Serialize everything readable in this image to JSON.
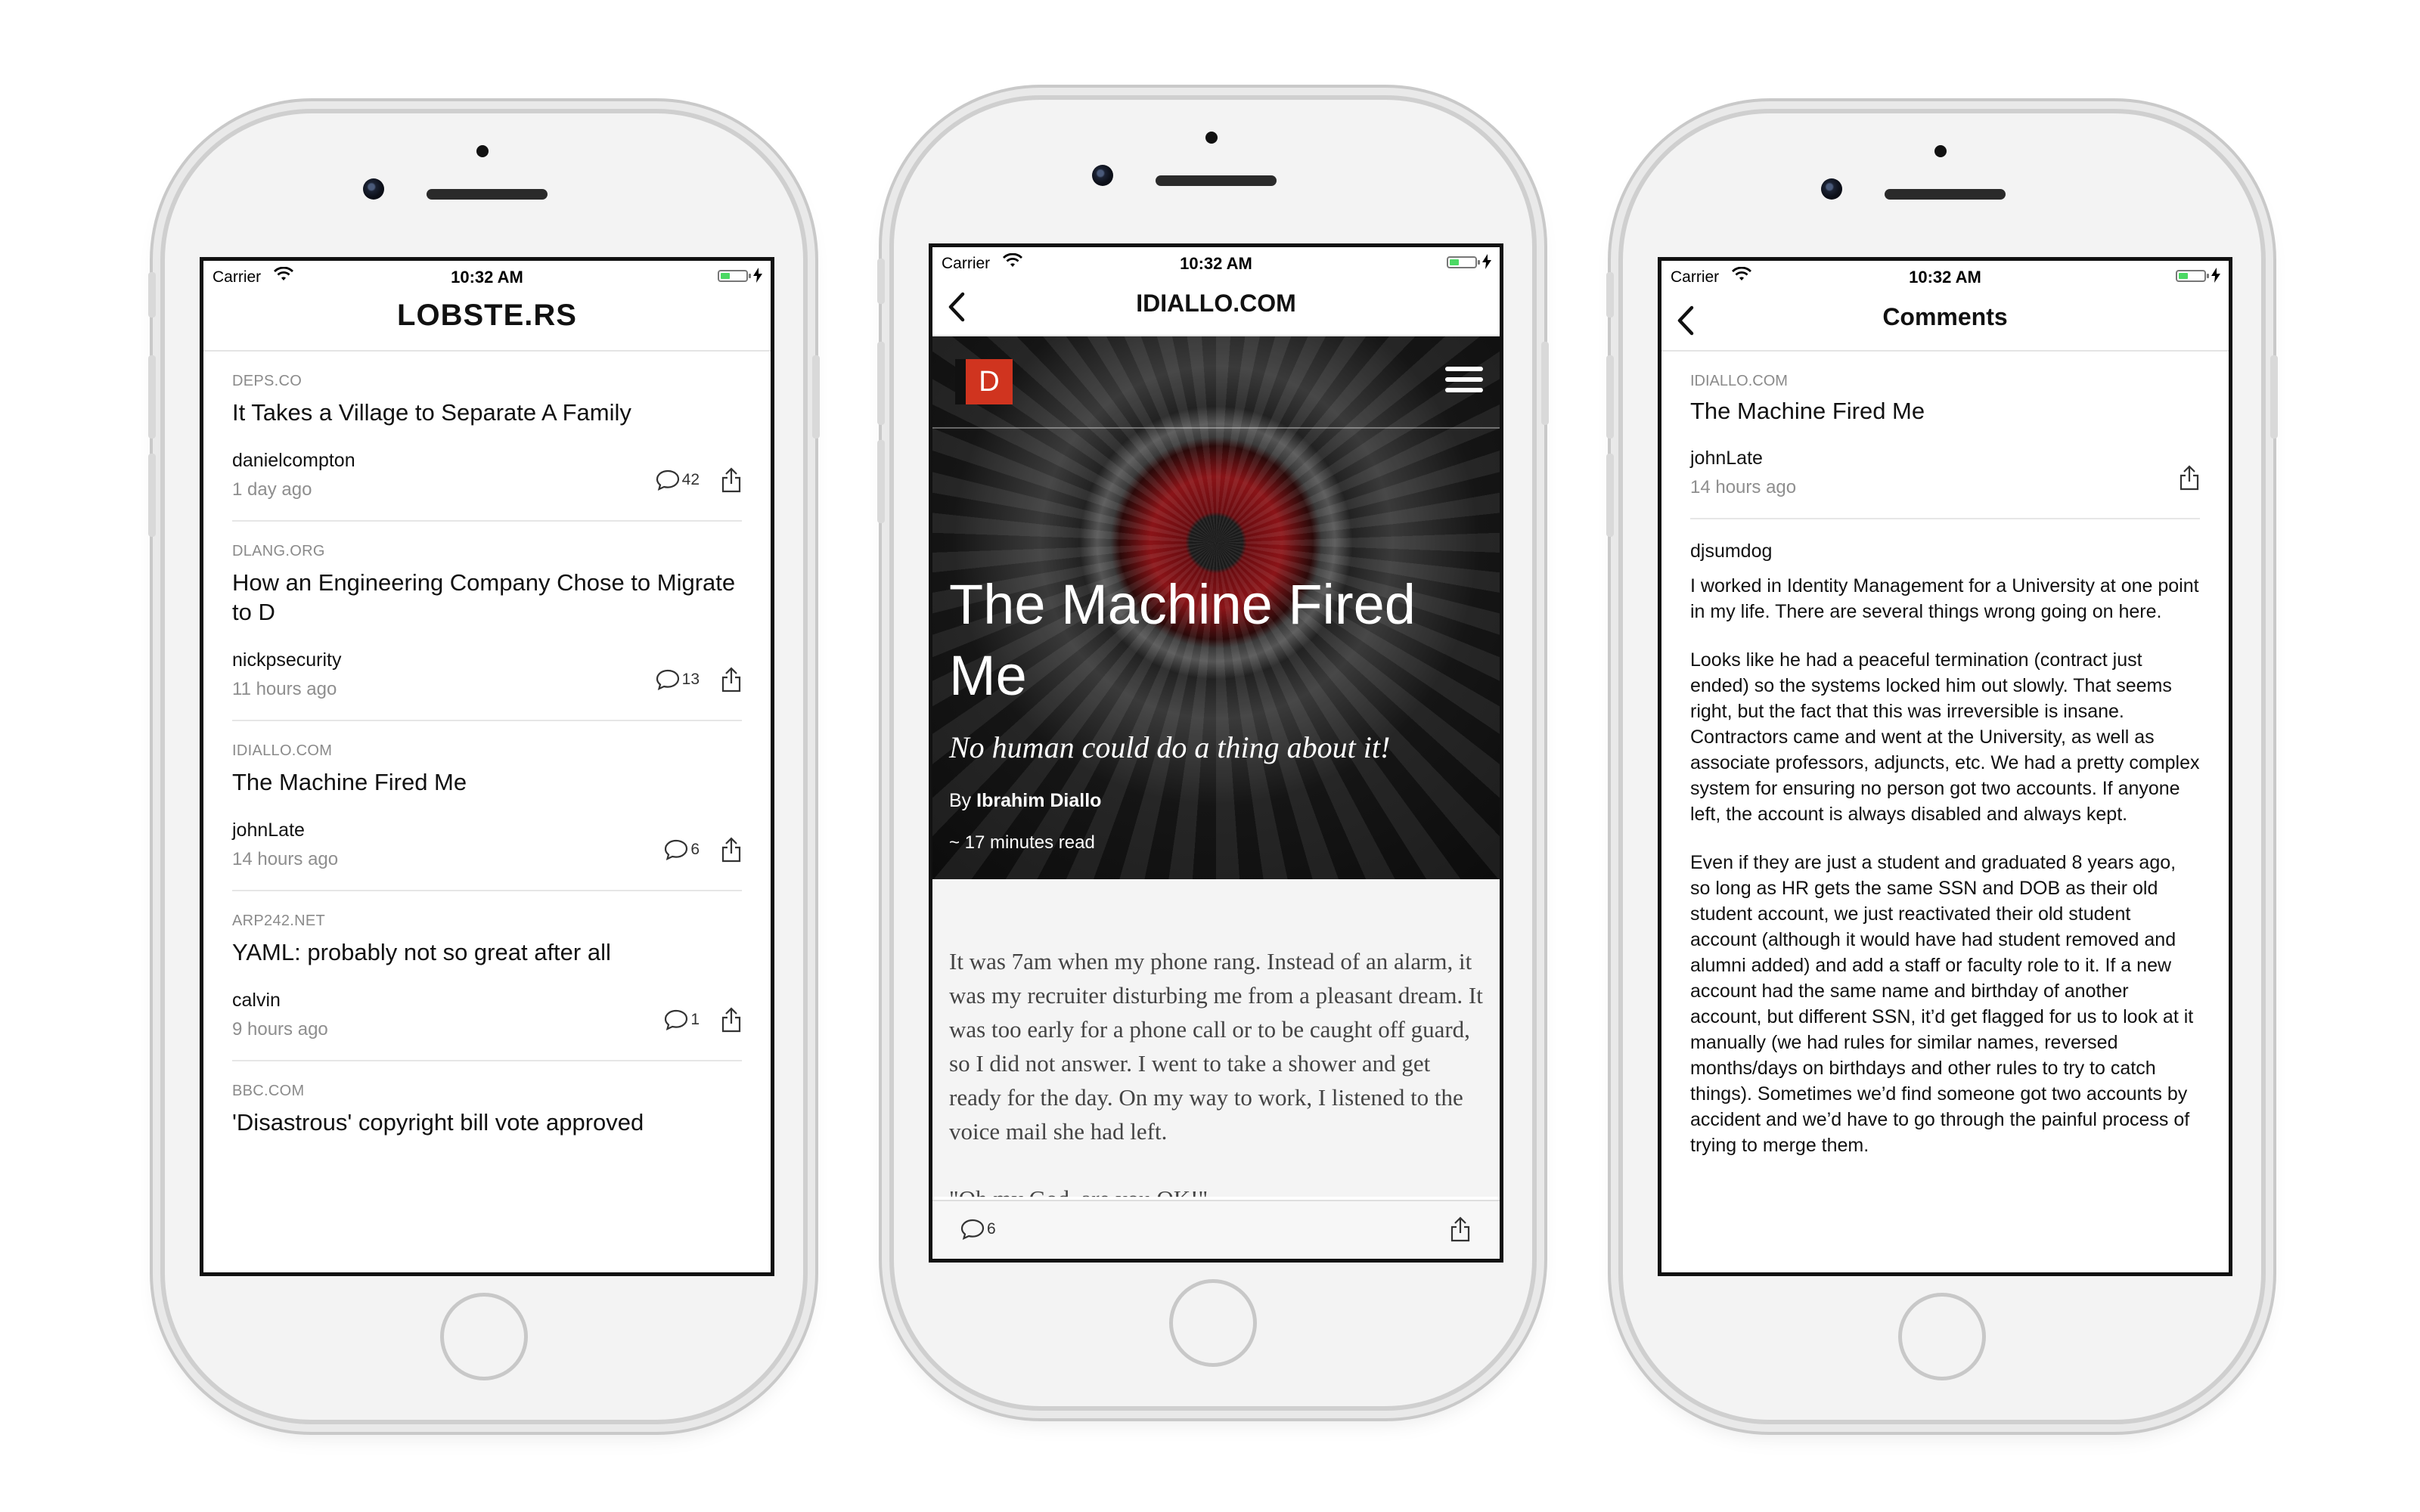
{
  "status_bar": {
    "carrier": "Carrier",
    "time": "10:32 AM"
  },
  "colors": {
    "battery_green": "#4cd964",
    "logo_red": "#d0341f",
    "accent": "#111111"
  },
  "list_screen": {
    "nav_title": "LOBSTE.RS",
    "stories": [
      {
        "domain": "DEPS.CO",
        "title": "It Takes a Village to Separate A Family",
        "author": "danielcompton",
        "time": "1 day ago",
        "comments": "42"
      },
      {
        "domain": "DLANG.ORG",
        "title": "How an Engineering Company Chose to Migrate to D",
        "author": "nickpsecurity",
        "time": "11 hours ago",
        "comments": "13"
      },
      {
        "domain": "IDIALLO.COM",
        "title": "The Machine Fired Me",
        "author": "johnLate",
        "time": "14 hours ago",
        "comments": "6"
      },
      {
        "domain": "ARP242.NET",
        "title": "YAML: probably not so great after all",
        "author": "calvin",
        "time": "9 hours ago",
        "comments": "1"
      },
      {
        "domain": "BBC.COM",
        "title": "'Disastrous' copyright bill vote approved"
      }
    ]
  },
  "article_screen": {
    "nav_title": "IDIALLO.COM",
    "logo_text": "D",
    "hero_title": "The Machine Fired Me",
    "hero_subtitle": "No human could do a thing about it!",
    "by_prefix": "By",
    "author": "Ibrahim Diallo",
    "read_time": "~ 17 minutes read",
    "paragraphs": [
      "It was 7am when my phone rang. Instead of an alarm, it was my recruiter disturbing me from a pleasant dream. It was too early for a phone call or to be caught off guard, so I did not answer. I went to take a shower and get ready for the day. On my way to work, I listened to the voice mail she had left.",
      "\"Oh my God, are you OK!\""
    ],
    "comments": "6"
  },
  "comments_screen": {
    "nav_title": "Comments",
    "story": {
      "domain": "IDIALLO.COM",
      "title": "The Machine Fired Me",
      "author": "johnLate",
      "time": "14 hours ago"
    },
    "comment": {
      "user": "djsumdog",
      "paragraphs": [
        "I worked in Identity Management for a University at one point in my life. There are several things wrong going on here.",
        "Looks like he had a peaceful termination (contract just ended) so the systems locked him out slowly. That seems right, but the fact that this was irreversible is insane. Contractors came and went at the University, as well as associate professors, adjuncts, etc. We had a pretty complex system for ensuring no person got two accounts. If anyone left, the account is always disabled and always kept.",
        "Even if they are just a student and graduated 8 years ago, so long as HR gets the same SSN and DOB as their old student account, we just reactivated their old student account (although it would have had student removed and alumni added) and add a staff or faculty role to it. If a new account had the same name and birthday of another account, but different SSN, it’d get flagged for us to look at it manually (we had rules for similar names, reversed months/days on birthdays and other rules to try to catch things). Sometimes we’d find someone got two accounts by accident and we’d have to go through the painful process of trying to merge them."
      ]
    }
  }
}
